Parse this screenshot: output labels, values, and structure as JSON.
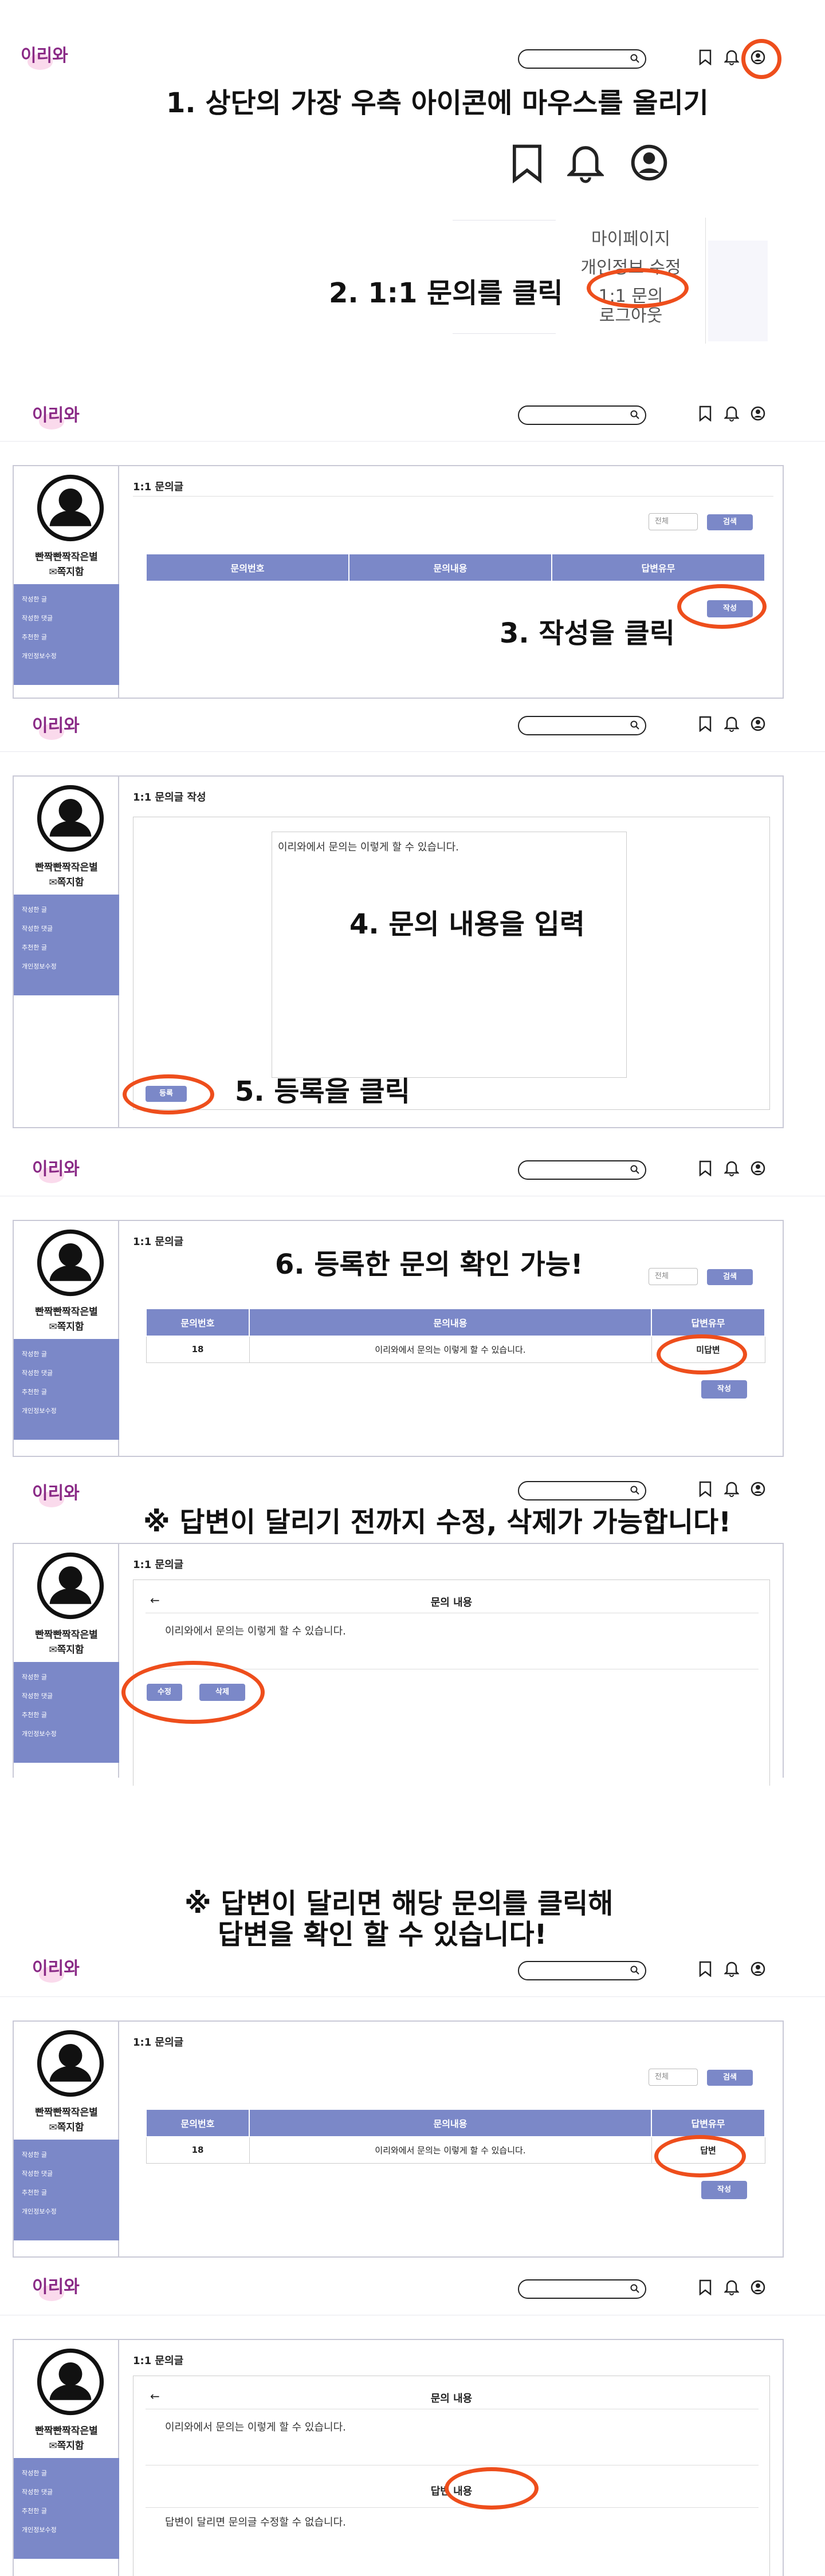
{
  "logo": "이리와",
  "user": {
    "name": "빤짝빤짝작은별",
    "mailbox": "✉쪽지함"
  },
  "sidebar": [
    "작성한 글",
    "작성한 댓글",
    "추천한 글",
    "개인정보수정"
  ],
  "steps": {
    "s1": "1. 상단의 가장 우측 아이콘에 마우스를 올리기",
    "s2": "2. 1:1 문의를 클릭",
    "s3": "3. 작성을 클릭",
    "s4": "4. 문의 내용을 입력",
    "s5": "5. 등록을 클릭",
    "s6": "6. 등록한 문의 확인 가능!",
    "note1": "※ 답변이 달리기 전까지 수정, 삭제가 가능합니다!",
    "note2a": "※ 답변이 달리면 해당 문의를 클릭해",
    "note2b": "답변을 확인 할 수 있습니다!"
  },
  "dropdown": {
    "mypage": "마이페이지",
    "edit": "개인정보 수정",
    "inquiry": "1:1 문의",
    "logout": "로그아웃"
  },
  "inquiry": {
    "list_title": "1:1 문의글",
    "write_title": "1:1 문의글 작성",
    "filter": "전체",
    "search_btn": "검색",
    "write_btn": "작성",
    "submit_btn": "등록",
    "edit_btn": "수정",
    "delete_btn": "삭제",
    "cols": [
      "문의번호",
      "문의내용",
      "답변유무"
    ],
    "row": {
      "no": "18",
      "content": "이리와에서 문의는 이렇게 할 수 있습니다.",
      "status_pending": "미답변",
      "status_done": "답변"
    },
    "detail_title": "문의 내용",
    "answer_title": "답변 내용",
    "answer_text": "답변이 달리면 문의글 수정할 수 없습니다."
  }
}
